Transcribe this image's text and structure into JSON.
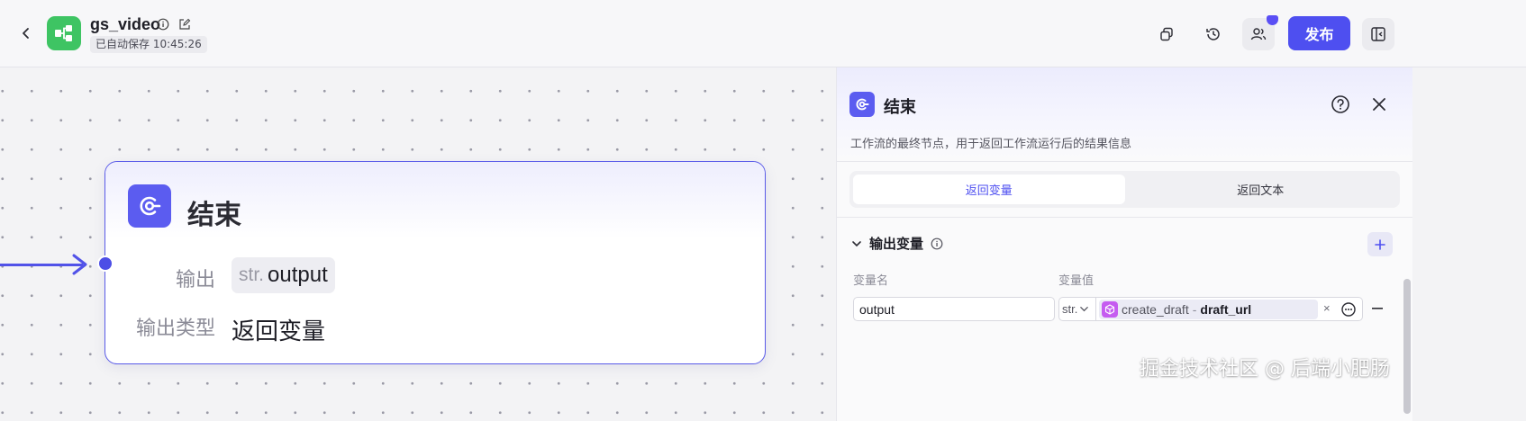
{
  "header": {
    "app_name": "gs_video",
    "autosave_text": "已自动保存 10:45:26",
    "publish_label": "发布",
    "icons": [
      "back-icon",
      "workflow-icon",
      "info-icon",
      "edit-icon",
      "copy-icon",
      "history-icon",
      "collaborators-icon",
      "sidebar-toggle-icon"
    ]
  },
  "node": {
    "title": "结束",
    "output_label": "输出",
    "output_type": "str.",
    "output_name": "output",
    "output_kind_label": "输出类型",
    "output_kind_value": "返回变量"
  },
  "panel": {
    "title": "结束",
    "description": "工作流的最终节点，用于返回工作流运行后的结果信息",
    "tabs": [
      {
        "label": "返回变量",
        "active": true
      },
      {
        "label": "返回文本",
        "active": false
      }
    ],
    "section_title": "输出变量",
    "columns": {
      "name": "变量名",
      "value": "变量值"
    },
    "row": {
      "name_value": "output",
      "type": "str.",
      "ref_node": "create_draft",
      "ref_separator": "-",
      "ref_var": "draft_url"
    }
  },
  "watermark": "掘金技术社区 @ 后端小肥肠",
  "colors": {
    "accent": "#4e4ff0",
    "app_icon": "#3ec463",
    "ref_icon": "#c55cf0"
  }
}
